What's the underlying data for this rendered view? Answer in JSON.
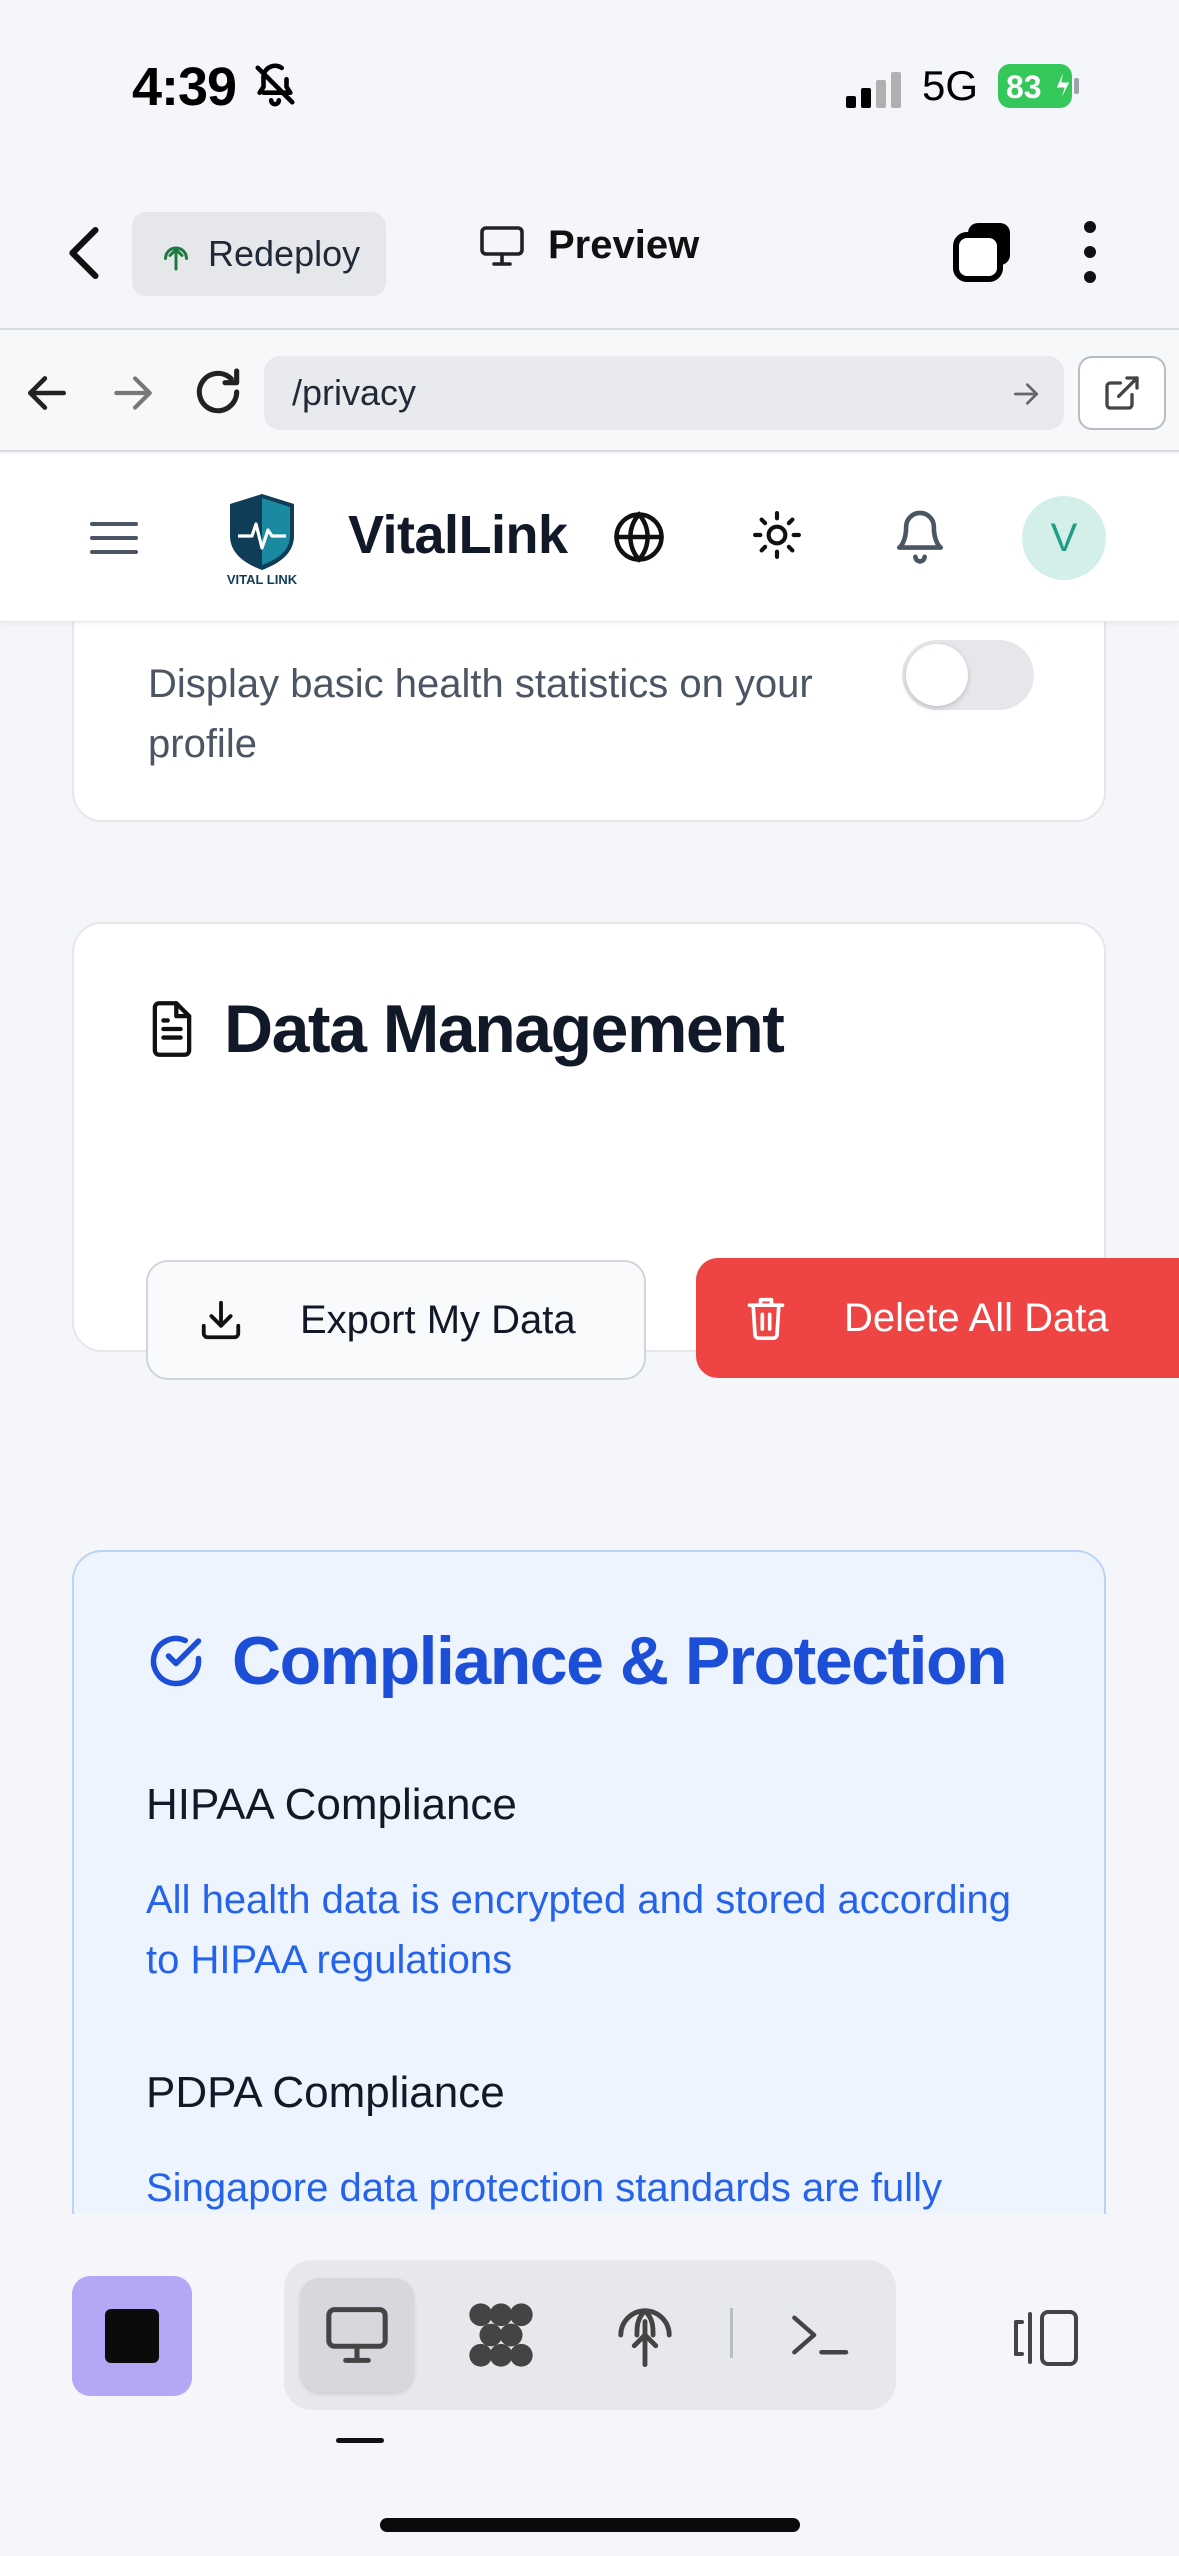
{
  "status_bar": {
    "time": "4:39",
    "network": "5G",
    "battery": "83"
  },
  "toolbar": {
    "redeploy_label": "Redeploy",
    "preview_label": "Preview"
  },
  "url_bar": {
    "path": "/privacy"
  },
  "app": {
    "title": "VitalLink",
    "logo_text": "VITAL LINK",
    "avatar_initial": "V"
  },
  "sections": {
    "stats_card": {
      "description": "Display basic health statistics on your profile",
      "toggle_on": false
    },
    "data_management": {
      "title": "Data Management",
      "export_label": "Export My Data",
      "delete_label": "Delete All Data"
    },
    "compliance": {
      "title": "Compliance & Protection",
      "items": [
        {
          "title": "HIPAA Compliance",
          "description": "All health data is encrypted and stored according to HIPAA regulations"
        },
        {
          "title": "PDPA Compliance",
          "description": "Singapore data protection standards are fully"
        }
      ]
    }
  },
  "colors": {
    "accent_blue": "#1d4ed8",
    "danger": "#ef4444",
    "stop_button": "#b4a7f5",
    "avatar_bg": "#d4efe9",
    "battery_green": "#34c759"
  },
  "icons": {
    "status": [
      "bell-slash-icon",
      "signal-icon",
      "battery-charging-icon"
    ],
    "toolbar": [
      "chevron-left-icon",
      "redeploy-icon",
      "monitor-icon",
      "tabs-icon",
      "more-vertical-icon"
    ],
    "url": [
      "arrow-left-icon",
      "arrow-right-icon",
      "reload-icon",
      "go-arrow-icon",
      "external-link-icon"
    ],
    "header": [
      "menu-icon",
      "globe-icon",
      "sun-icon",
      "bell-icon"
    ],
    "bottom": [
      "stop-icon",
      "monitor-icon",
      "workflows-icon",
      "deploy-icon",
      "terminal-icon",
      "panel-icon"
    ]
  }
}
